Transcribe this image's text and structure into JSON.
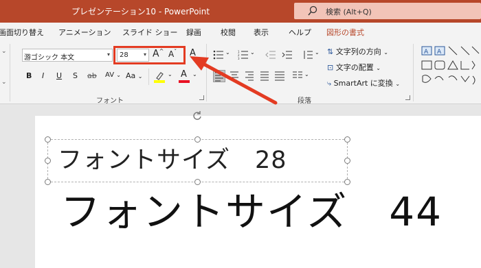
{
  "window": {
    "title": "プレゼンテーション10  -  PowerPoint",
    "search_placeholder": "検索 (Alt+Q)",
    "search_icon": "search-icon"
  },
  "tabs": [
    {
      "label": "画面切り替え"
    },
    {
      "label": "アニメーション"
    },
    {
      "label": "スライド ショー"
    },
    {
      "label": "録画"
    },
    {
      "label": "校閲"
    },
    {
      "label": "表示"
    },
    {
      "label": "ヘルプ"
    },
    {
      "label": "図形の書式",
      "active": true
    }
  ],
  "ribbon": {
    "font_name": "游ゴシック 本文",
    "font_size": "28",
    "grow_font": "A",
    "shrink_font": "A",
    "clear_format": "A",
    "bold": "B",
    "italic": "I",
    "underline": "U",
    "shadow": "S",
    "strikethrough": "ab",
    "spacing": "AV",
    "change_case": "Aa",
    "font_color": "A",
    "font_group_label": "フォント",
    "text_direction": "文字列の方向",
    "align_text": "文字の配置",
    "smartart": "SmartArt に変換",
    "paragraph_group_label": "段落",
    "highlight_color": "#ffff00",
    "font_color_bar": "#e81123"
  },
  "slide": {
    "text_28": "フォントサイズ　28",
    "text_44": "フォントサイズ　44"
  },
  "colors": {
    "accent": "#b7472a",
    "annotation": "#e33b22"
  }
}
